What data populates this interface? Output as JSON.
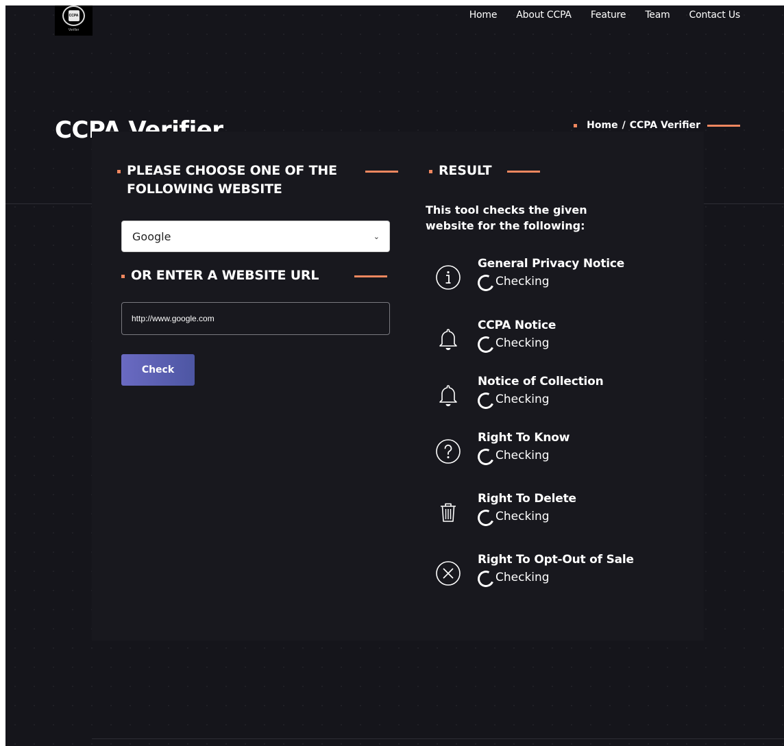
{
  "logo": {
    "caption": "Verifier",
    "badge": "CCPA"
  },
  "nav": {
    "items": [
      "Home",
      "About CCPA",
      "Feature",
      "Team",
      "Contact Us"
    ]
  },
  "page_title": "CCPA Verifier",
  "breadcrumb": {
    "home": "Home",
    "separator": "/",
    "current": "CCPA Verifier"
  },
  "form": {
    "choose_heading": "PLEASE CHOOSE ONE OF THE FOLLOWING WEBSITE",
    "selected_site": "Google",
    "url_heading": "OR ENTER A WEBSITE URL",
    "url_value": "http://www.google.com",
    "check_label": "Check"
  },
  "result": {
    "heading": "RESULT",
    "intro": "This tool checks the given website for the following:",
    "items": [
      {
        "title": "General Privacy Notice",
        "status": "Checking",
        "icon": "info-icon"
      },
      {
        "title": "CCPA Notice",
        "status": "Checking",
        "icon": "bell-icon"
      },
      {
        "title": "Notice of Collection",
        "status": "Checking",
        "icon": "bell-icon"
      },
      {
        "title": "Right To Know",
        "status": "Checking",
        "icon": "question-icon"
      },
      {
        "title": "Right To Delete",
        "status": "Checking",
        "icon": "trash-icon"
      },
      {
        "title": "Right To Opt-Out of Sale",
        "status": "Checking",
        "icon": "close-circle-icon"
      }
    ]
  },
  "colors": {
    "accent": "#f0875f",
    "background": "#15151b",
    "card": "#18181e",
    "button": "#5a5fb3"
  }
}
